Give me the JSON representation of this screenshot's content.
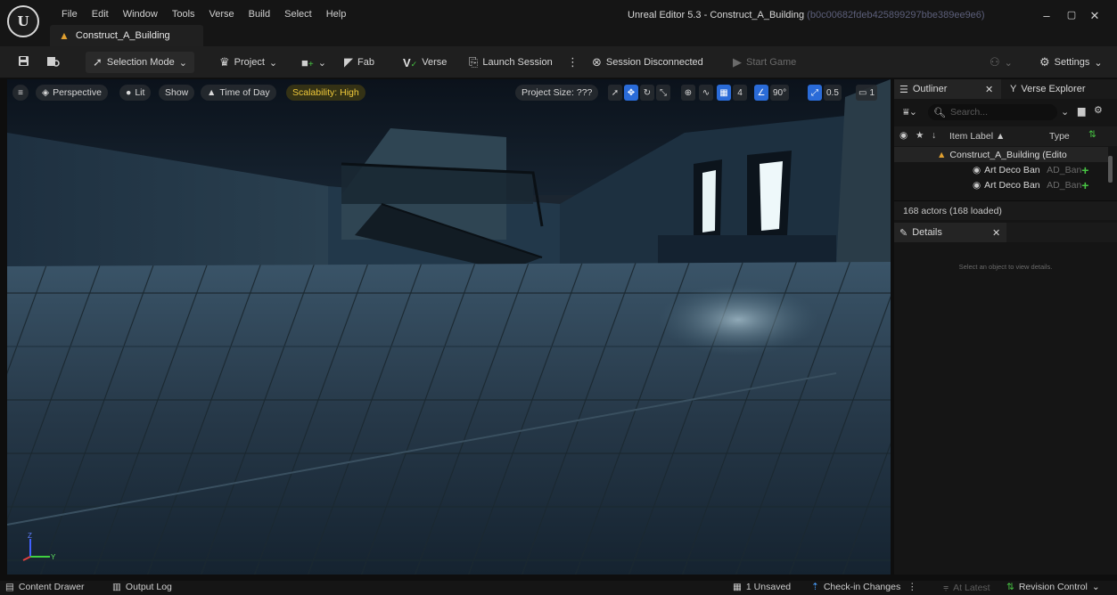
{
  "app": {
    "menu": [
      "File",
      "Edit",
      "Window",
      "Tools",
      "Verse",
      "Build",
      "Select",
      "Help"
    ],
    "window_title": "Unreal Editor 5.3 - Construct_A_Building",
    "window_hash": "(b0c00682fdeb425899297bbe389ee9e6)",
    "doc_tab": "Construct_A_Building"
  },
  "toolbar": {
    "selection_mode": "Selection Mode",
    "project": "Project",
    "fab": "Fab",
    "verse": "Verse",
    "launch_session": "Launch Session",
    "session_status": "Session Disconnected",
    "start_game": "Start Game",
    "settings": "Settings"
  },
  "viewport": {
    "perspective": "Perspective",
    "lit": "Lit",
    "show": "Show",
    "time_of_day": "Time of Day",
    "scalability": "Scalability: High",
    "project_size": "Project Size: ???",
    "grid_snap": "4",
    "rotation_snap": "90°",
    "scale_snap": "0.5",
    "camera_speed": "1",
    "axis_labels": [
      "Z",
      "Y"
    ]
  },
  "outliner": {
    "tab_outliner": "Outliner",
    "tab_verse": "Verse Explorer",
    "search_placeholder": "Search...",
    "col_label": "Item Label ▲",
    "col_type": "Type",
    "rows": [
      {
        "label": "Construct_A_Building (Edito",
        "type": ""
      },
      {
        "label": "Art Deco Ban",
        "type": "AD_Ban"
      },
      {
        "label": "Art Deco Ban",
        "type": "AD_Ban"
      }
    ],
    "actor_count": "168 actors (168 loaded)"
  },
  "details": {
    "tab": "Details",
    "empty": "Select an object to view details."
  },
  "statusbar": {
    "content_drawer": "Content Drawer",
    "output_log": "Output Log",
    "unsaved": "1 Unsaved",
    "check_in": "Check-in Changes",
    "at_latest": "At Latest",
    "revision_control": "Revision Control"
  }
}
